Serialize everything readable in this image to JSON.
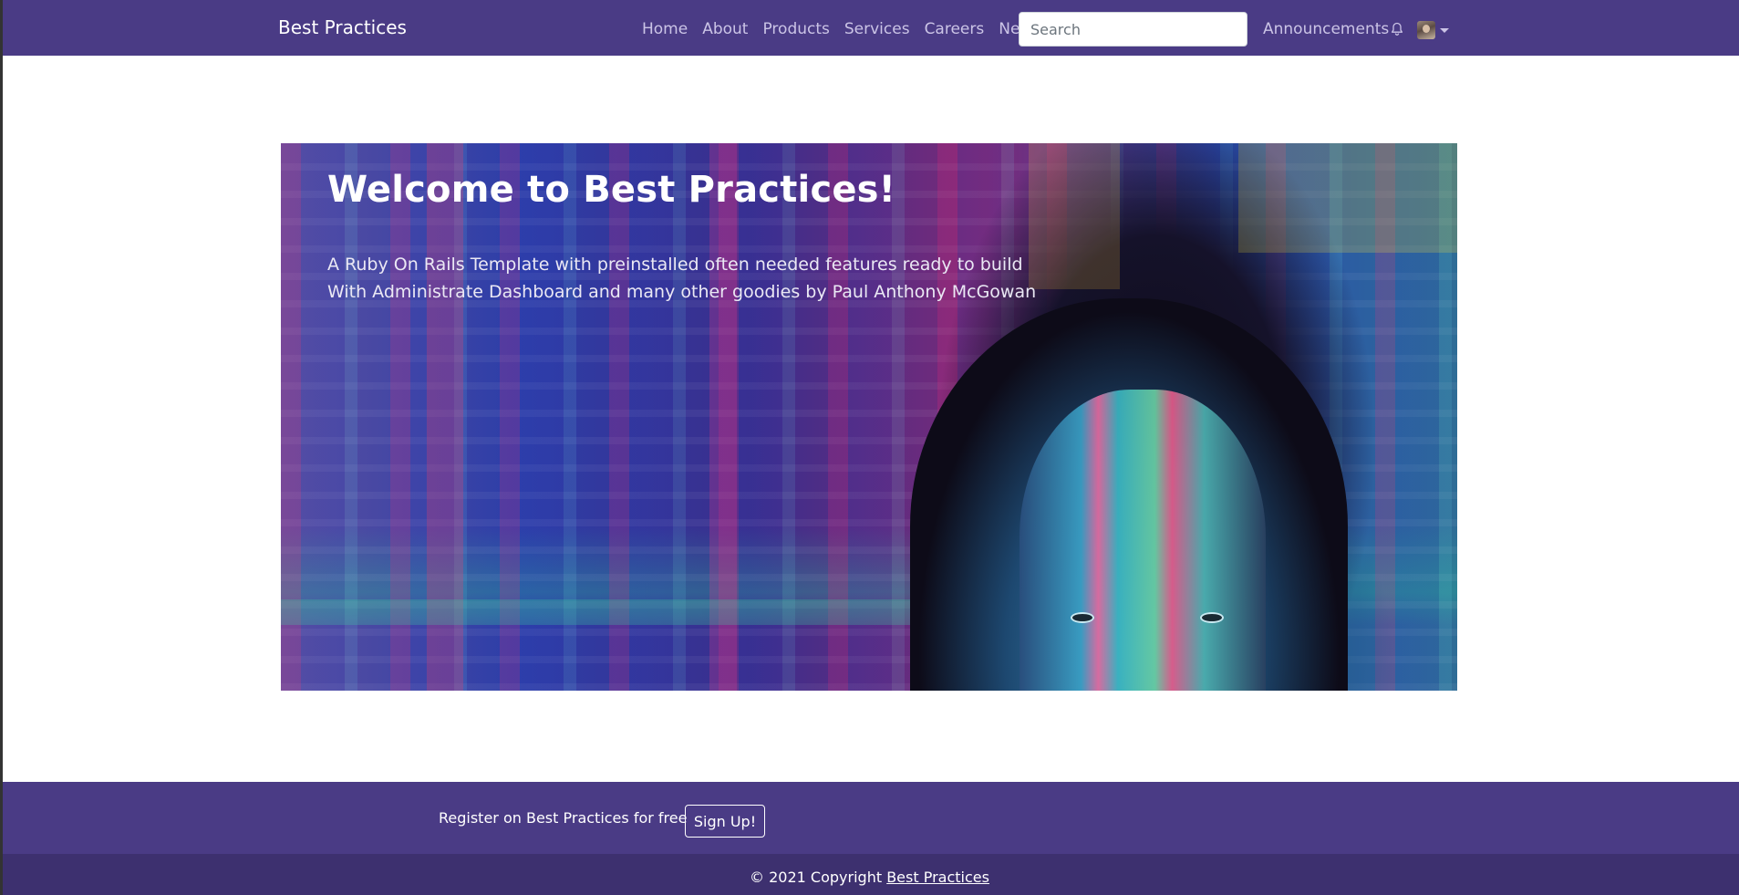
{
  "navbar": {
    "brand": "Best Practices",
    "links": [
      "Home",
      "About",
      "Products",
      "Services",
      "Careers",
      "News"
    ],
    "search_placeholder": "Search",
    "announcements": "Announcements",
    "bell_icon": "bell-icon",
    "avatar_icon": "user-avatar",
    "dropdown_icon": "caret-down-icon"
  },
  "hero": {
    "title": "Welcome to Best Practices!",
    "line1": "A Ruby On Rails Template with preinstalled often needed features ready to build",
    "line2": "With Administrate Dashboard and many other goodies by Paul Anthony McGowan"
  },
  "cta": {
    "text": "Register on Best Practices for free",
    "button": "Sign Up!"
  },
  "footer": {
    "prefix": "© 2021 Copyright",
    "link": "Best Practices"
  },
  "colors": {
    "navbar": "#4a3b85",
    "footer": "#3d306f",
    "nav_link": "#cbc4e6"
  }
}
